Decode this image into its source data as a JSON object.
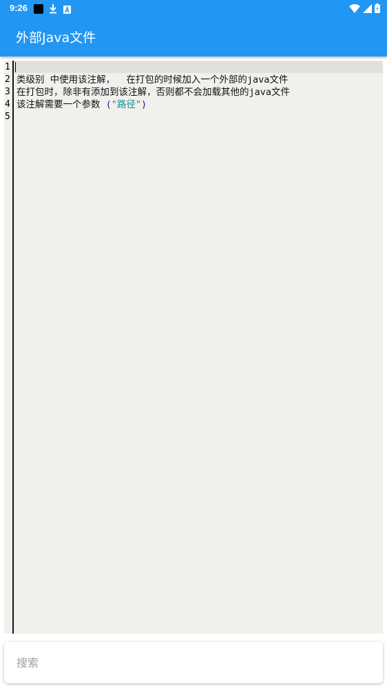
{
  "status_bar": {
    "time": "9:26",
    "icons": [
      "app-notification-icon",
      "download-icon",
      "a-badge-icon",
      "wifi-icon",
      "signal-icon",
      "battery-icon"
    ]
  },
  "app_bar": {
    "title": "外部Java文件"
  },
  "editor": {
    "line_numbers": [
      "1",
      "2",
      "3",
      "4",
      "5"
    ],
    "lines": [
      {
        "segments": []
      },
      {
        "segments": [
          {
            "text": "类级别 中使用该注解",
            "kind": "text"
          },
          {
            "text": "，",
            "kind": "punct"
          },
          {
            "text": "  在打包的时候加入一个外部的java文件",
            "kind": "text"
          }
        ]
      },
      {
        "segments": [
          {
            "text": "在打包时",
            "kind": "text"
          },
          {
            "text": "，",
            "kind": "punct"
          },
          {
            "text": "除非有添加到该注解",
            "kind": "text"
          },
          {
            "text": "，",
            "kind": "punct"
          },
          {
            "text": "否则都不会加载其他的java文件",
            "kind": "text"
          }
        ]
      },
      {
        "segments": [
          {
            "text": "该注解需要一个参数 ",
            "kind": "text"
          },
          {
            "text": "(",
            "kind": "punct"
          },
          {
            "text": "\"路径\"",
            "kind": "str"
          },
          {
            "text": ")",
            "kind": "punct"
          }
        ]
      },
      {
        "segments": []
      }
    ]
  },
  "search": {
    "placeholder": "搜索",
    "value": ""
  },
  "colors": {
    "primary": "#2196f3",
    "editor_bg": "#f0f0ec",
    "punct": "#1a1aa6",
    "string": "#11908a"
  }
}
